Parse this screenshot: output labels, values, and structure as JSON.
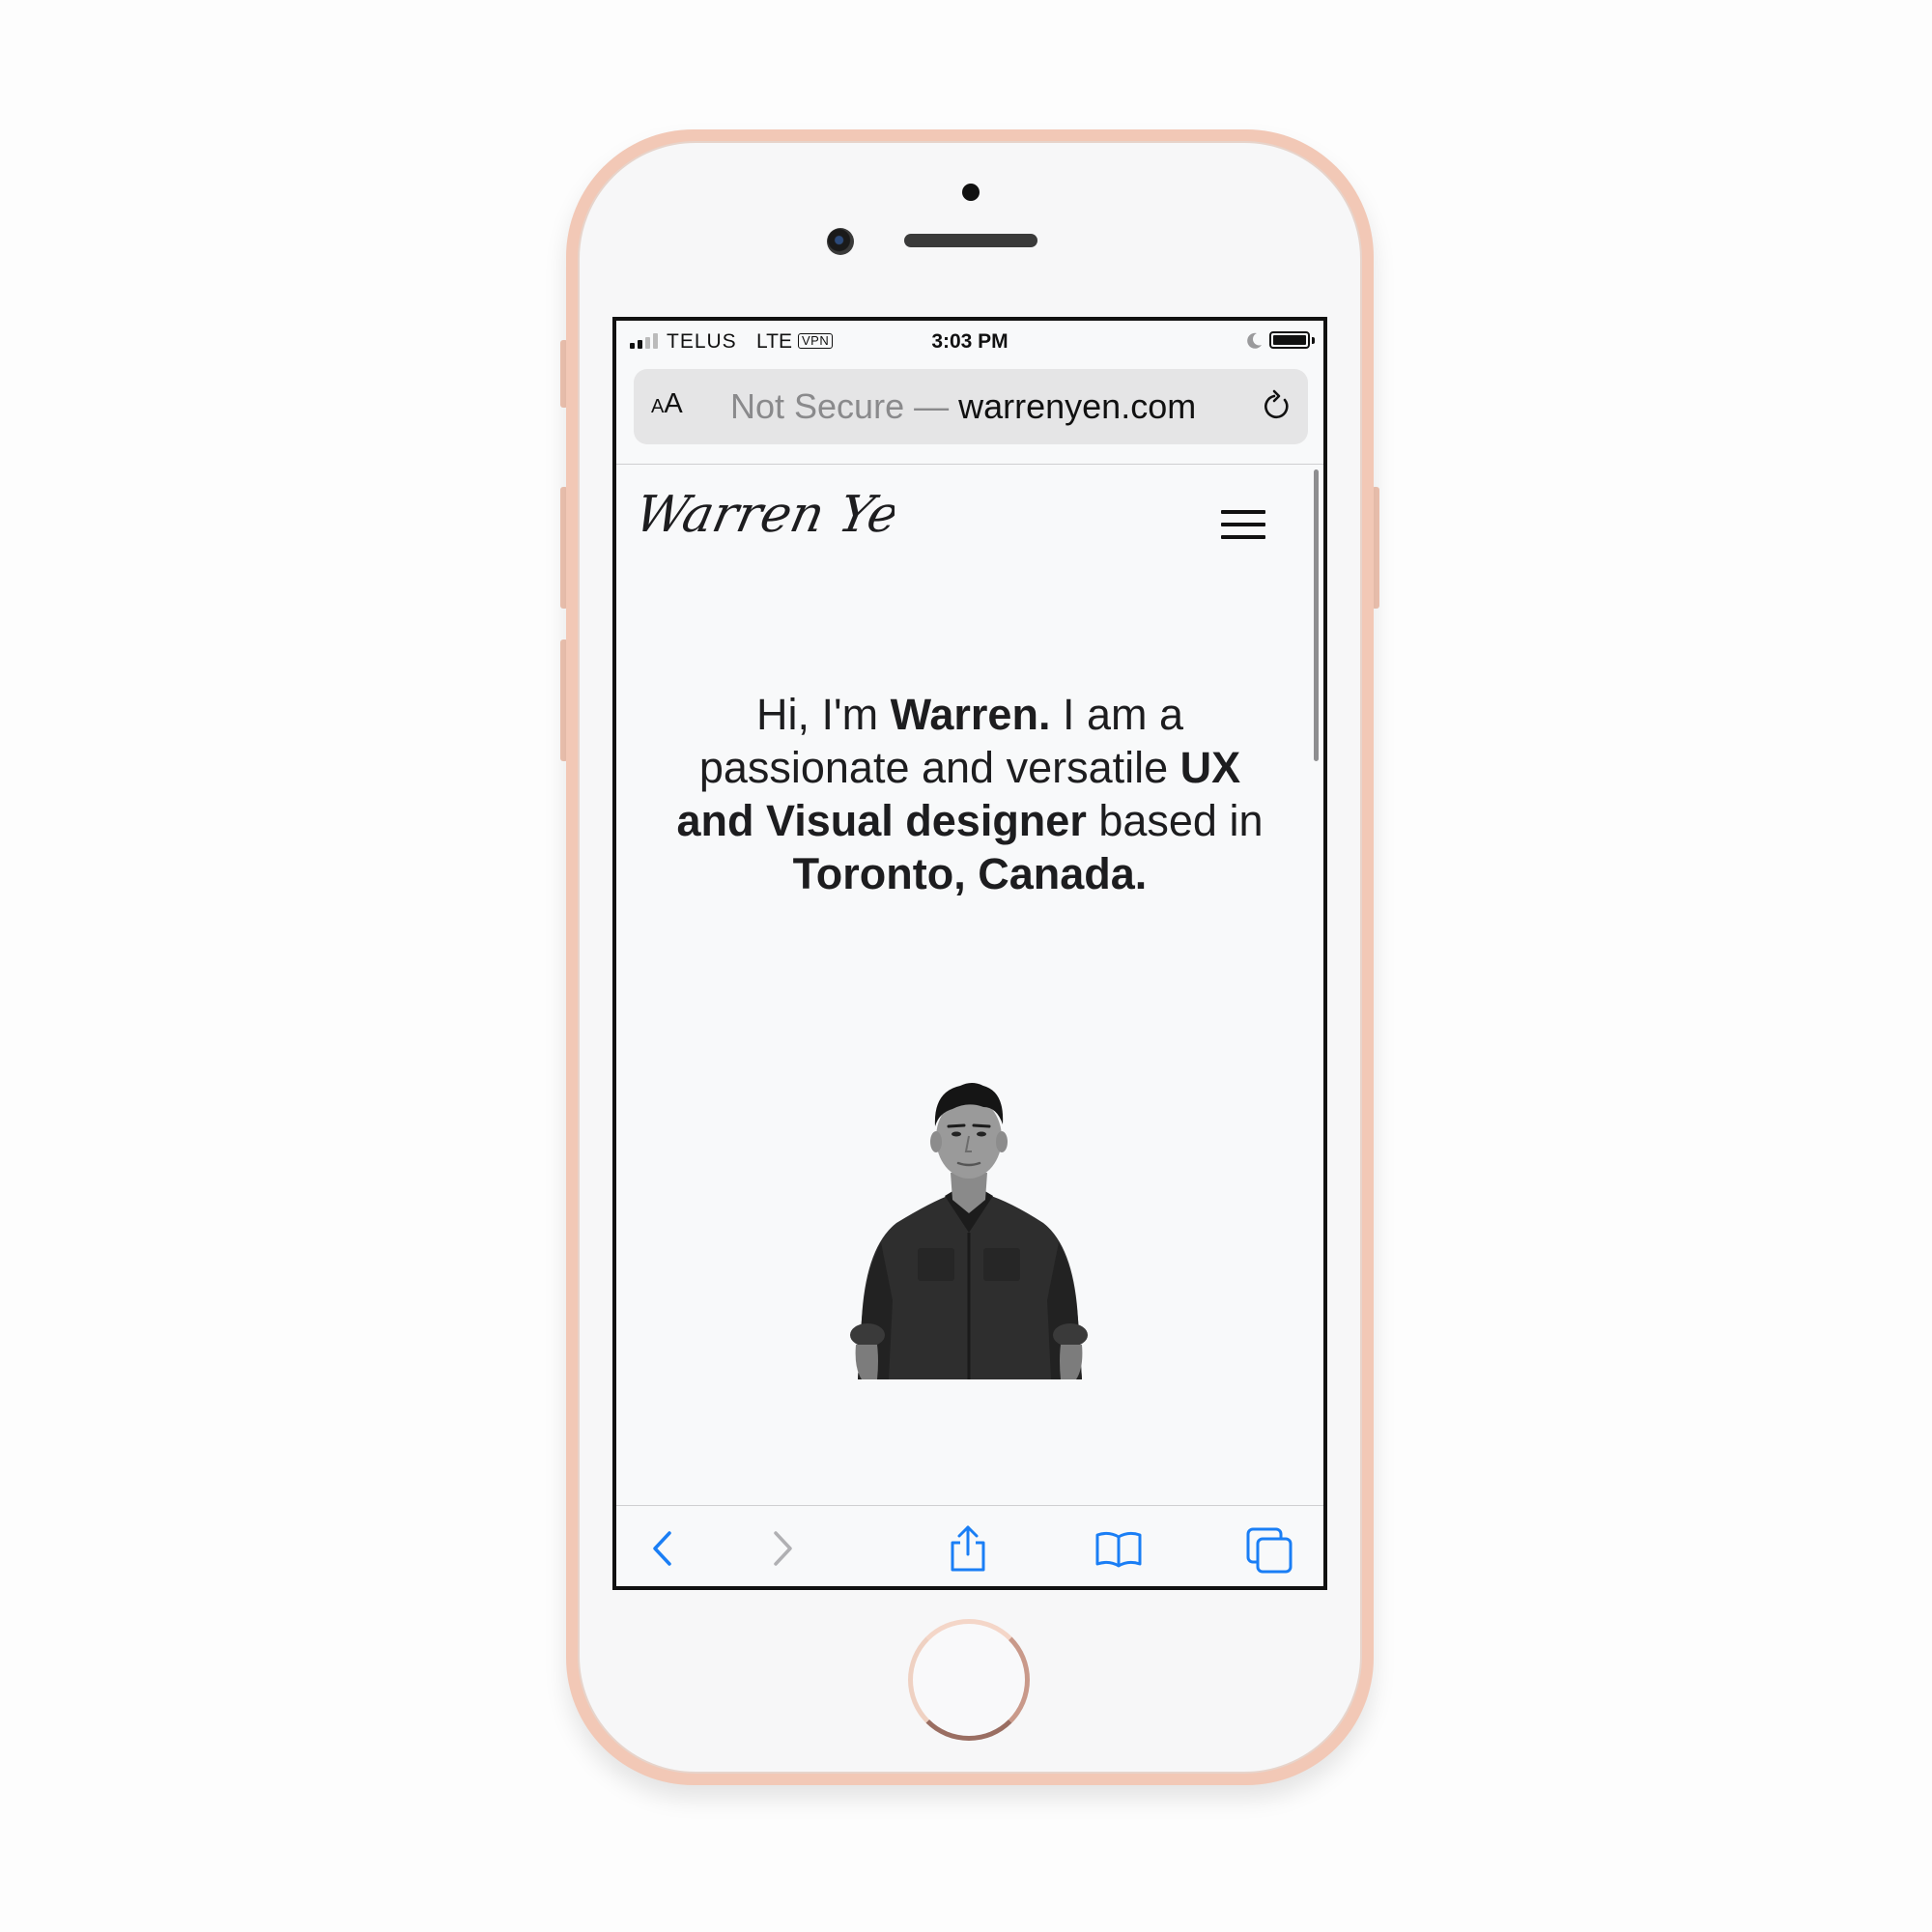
{
  "status_bar": {
    "carrier": "TELUS",
    "network": "LTE",
    "vpn_badge": "VPN",
    "time": "3:03 PM",
    "signal_bars": 2,
    "signal_bars_total": 4,
    "icons": [
      "signal-icon",
      "moon-icon",
      "battery-icon"
    ]
  },
  "address_bar": {
    "text_size_button": "AA",
    "security_label": "Not Secure —",
    "domain": "warrenyen.com",
    "reload_icon": "reload-icon"
  },
  "site": {
    "logo_text": "Warren Yen",
    "menu_icon": "hamburger-menu-icon",
    "hero": {
      "p1": "Hi, I'm ",
      "b1": "Warren.",
      "p2": " I am a passionate and versatile ",
      "b2": "UX and Visual designer",
      "p3": " based in ",
      "b3": "Toronto, Canada."
    },
    "portrait_alt": "Black and white portrait photo"
  },
  "browser_toolbar": {
    "buttons": [
      {
        "name": "back-button",
        "icon": "chevron-left-icon",
        "enabled": true
      },
      {
        "name": "forward-button",
        "icon": "chevron-right-icon",
        "enabled": false
      },
      {
        "name": "share-button",
        "icon": "share-icon",
        "enabled": true
      },
      {
        "name": "bookmarks-button",
        "icon": "book-icon",
        "enabled": true
      },
      {
        "name": "tabs-button",
        "icon": "tabs-icon",
        "enabled": true
      }
    ]
  },
  "colors": {
    "phone_frame": "#f2c8b6",
    "link_blue": "#1a7ef5",
    "disabled_gray": "#b0b0b3",
    "page_background": "#f8f9fa",
    "text": "#1d1d1f"
  }
}
